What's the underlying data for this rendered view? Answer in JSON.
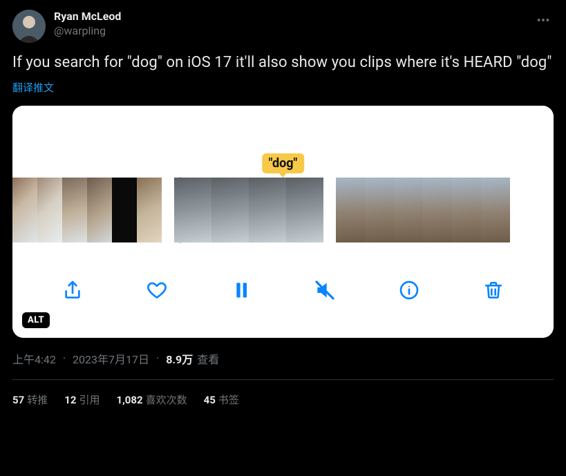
{
  "author": {
    "display_name": "Ryan McLeod",
    "handle": "@warpling"
  },
  "tweet_text": "If you search for \"dog\" on iOS 17 it'll also show you clips where it's HEARD \"dog\"",
  "translate_label": "翻译推文",
  "media": {
    "caption_chip": "\"dog\"",
    "alt_badge": "ALT",
    "toolbar": {
      "share": "share-icon",
      "like": "heart-icon",
      "pause": "pause-icon",
      "mute": "mute-icon",
      "info": "info-icon",
      "trash": "trash-icon"
    }
  },
  "meta": {
    "time": "上午4:42",
    "date": "2023年7月17日",
    "views_value": "8.9万",
    "views_label": "查看"
  },
  "stats": {
    "retweets": {
      "value": "57",
      "label": "转推"
    },
    "quotes": {
      "value": "12",
      "label": "引用"
    },
    "likes": {
      "value": "1,082",
      "label": "喜欢次数"
    },
    "bookmarks": {
      "value": "45",
      "label": "书签"
    }
  }
}
